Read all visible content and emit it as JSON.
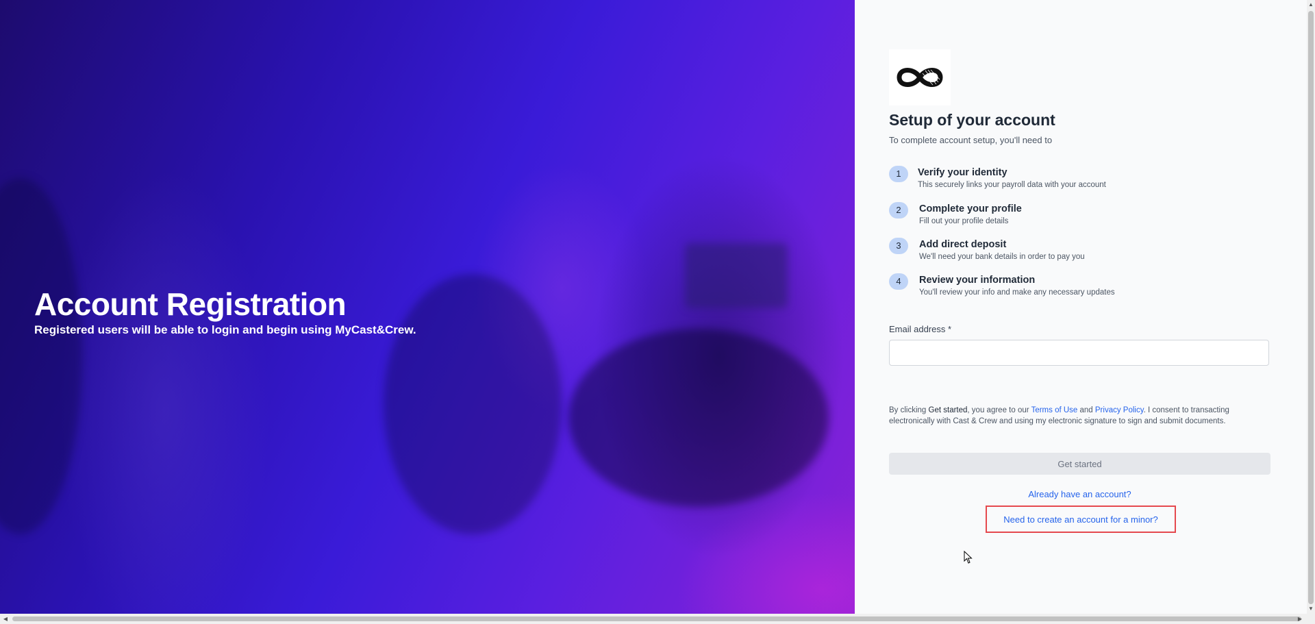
{
  "hero": {
    "title": "Account Registration",
    "subtitle": "Registered users will be able to login and begin using MyCast&Crew."
  },
  "setup": {
    "title": "Setup of your account",
    "subtitle": "To complete account setup, you'll need to",
    "steps": [
      {
        "num": "1",
        "title": "Verify your identity",
        "desc": "This securely links your payroll data with your account"
      },
      {
        "num": "2",
        "title": "Complete your profile",
        "desc": "Fill out your profile details"
      },
      {
        "num": "3",
        "title": "Add direct deposit",
        "desc": "We'll need your bank details in order to pay you"
      },
      {
        "num": "4",
        "title": "Review your information",
        "desc": "You'll review your info and make any necessary updates"
      }
    ]
  },
  "form": {
    "email_label": "Email address *",
    "email_value": "",
    "consent_prefix": "By clicking ",
    "consent_strong": "Get started",
    "consent_mid": ", you agree to our ",
    "terms_link": "Terms of Use",
    "consent_and": " and ",
    "privacy_link": "Privacy Policy",
    "consent_suffix": ". I consent to transacting electronically with Cast & Crew and using my electronic signature to sign and submit documents.",
    "submit_label": "Get started",
    "have_account_link": "Already have an account?",
    "minor_link": "Need to create an account for a minor?"
  },
  "colors": {
    "accent_link": "#2563eb",
    "step_badge": "#bfd4f7",
    "highlight_box": "#e5484d"
  },
  "icons": {
    "logo": "cast-and-crew-infinity-logo",
    "cursor": "mouse-pointer-icon"
  }
}
